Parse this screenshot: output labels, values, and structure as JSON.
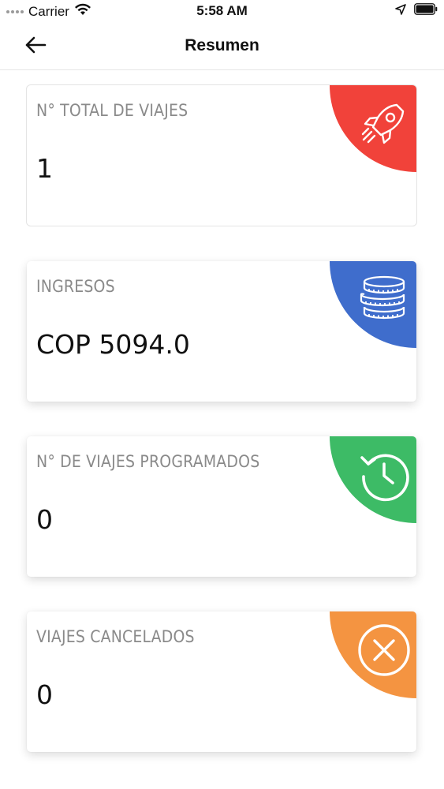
{
  "status_bar": {
    "carrier": "Carrier",
    "time": "5:58 AM"
  },
  "nav": {
    "title": "Resumen"
  },
  "cards": [
    {
      "label": "N° TOTAL DE VIAJES",
      "value": "1",
      "color": "#f1423a",
      "icon": "rocket-icon"
    },
    {
      "label": "INGRESOS",
      "value": "COP 5094.0",
      "color": "#3f6dcc",
      "icon": "coins-icon"
    },
    {
      "label": "N° DE VIAJES PROGRAMADOS",
      "value": "0",
      "color": "#3dbb66",
      "icon": "history-clock-icon"
    },
    {
      "label": "VIAJES CANCELADOS",
      "value": "0",
      "color": "#f49441",
      "icon": "cancel-circle-icon"
    }
  ]
}
